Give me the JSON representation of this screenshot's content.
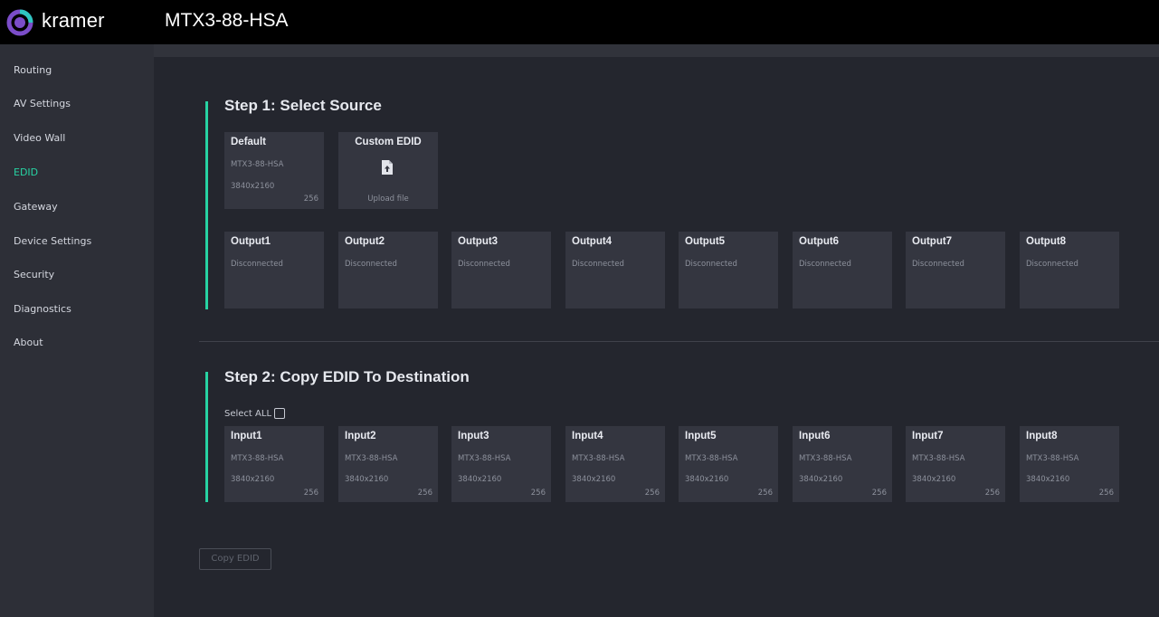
{
  "header": {
    "brand": "kramer",
    "device_name": "MTX3-88-HSA",
    "brand_colors": {
      "logo_purple": "#7b4dc9",
      "logo_teal": "#2ec6c0"
    }
  },
  "sidebar": {
    "active_color": "#27d3a3",
    "items": [
      {
        "label": "Routing",
        "active": false
      },
      {
        "label": "AV Settings",
        "active": false
      },
      {
        "label": "Video Wall",
        "active": false
      },
      {
        "label": "EDID",
        "active": true
      },
      {
        "label": "Gateway",
        "active": false
      },
      {
        "label": "Device Settings",
        "active": false
      },
      {
        "label": "Security",
        "active": false
      },
      {
        "label": "Diagnostics",
        "active": false
      },
      {
        "label": "About",
        "active": false
      }
    ]
  },
  "step1": {
    "title": "Step 1: Select Source",
    "default_card": {
      "title": "Default",
      "model": "MTX3-88-HSA",
      "resolution": "3840x2160",
      "size": "256"
    },
    "custom_card": {
      "title": "Custom EDID",
      "icon": "file-upload-icon",
      "action": "Upload file"
    },
    "outputs": [
      {
        "title": "Output1",
        "status": "Disconnected"
      },
      {
        "title": "Output2",
        "status": "Disconnected"
      },
      {
        "title": "Output3",
        "status": "Disconnected"
      },
      {
        "title": "Output4",
        "status": "Disconnected"
      },
      {
        "title": "Output5",
        "status": "Disconnected"
      },
      {
        "title": "Output6",
        "status": "Disconnected"
      },
      {
        "title": "Output7",
        "status": "Disconnected"
      },
      {
        "title": "Output8",
        "status": "Disconnected"
      }
    ]
  },
  "step2": {
    "title": "Step 2: Copy EDID To Destination",
    "select_all_label": "Select ALL",
    "inputs": [
      {
        "title": "Input1",
        "model": "MTX3-88-HSA",
        "resolution": "3840x2160",
        "size": "256"
      },
      {
        "title": "Input2",
        "model": "MTX3-88-HSA",
        "resolution": "3840x2160",
        "size": "256"
      },
      {
        "title": "Input3",
        "model": "MTX3-88-HSA",
        "resolution": "3840x2160",
        "size": "256"
      },
      {
        "title": "Input4",
        "model": "MTX3-88-HSA",
        "resolution": "3840x2160",
        "size": "256"
      },
      {
        "title": "Input5",
        "model": "MTX3-88-HSA",
        "resolution": "3840x2160",
        "size": "256"
      },
      {
        "title": "Input6",
        "model": "MTX3-88-HSA",
        "resolution": "3840x2160",
        "size": "256"
      },
      {
        "title": "Input7",
        "model": "MTX3-88-HSA",
        "resolution": "3840x2160",
        "size": "256"
      },
      {
        "title": "Input8",
        "model": "MTX3-88-HSA",
        "resolution": "3840x2160",
        "size": "256"
      }
    ]
  },
  "actions": {
    "copy_label": "Copy EDID"
  }
}
